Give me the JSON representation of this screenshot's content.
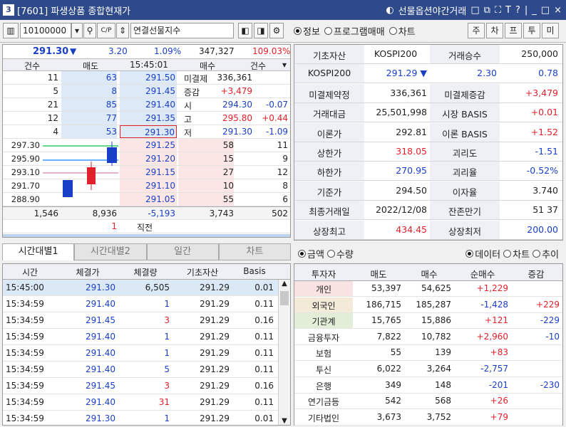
{
  "title": {
    "num": "3",
    "text": "[7601] 파생상품 종합현재가",
    "mode": "선물옵션야간거래",
    "icons": [
      "□",
      "⧉",
      "⛶",
      "T",
      "?",
      "|",
      "_",
      "□",
      "×"
    ]
  },
  "toolbar": {
    "code": "10100000",
    "name": "연결선물지수",
    "tabs_radio": [
      "정보",
      "프로그램매매",
      "차트"
    ],
    "buttons": [
      "주",
      "차",
      "프",
      "투",
      "미"
    ]
  },
  "quote": {
    "price": "291.30",
    "arrow": "▼",
    "change": "3.20",
    "rate": "1.09%",
    "volume": "347,327",
    "vol_rate": "109.03%"
  },
  "ob_header": [
    "건수",
    "매도",
    "15:45:01",
    "매수",
    "건수"
  ],
  "asks": [
    {
      "cnt": "11",
      "qty": "63",
      "price": "291.50"
    },
    {
      "cnt": "5",
      "qty": "8",
      "price": "291.45"
    },
    {
      "cnt": "21",
      "qty": "85",
      "price": "291.40"
    },
    {
      "cnt": "12",
      "qty": "77",
      "price": "291.35"
    },
    {
      "cnt": "4",
      "qty": "53",
      "price": "291.30"
    }
  ],
  "side_info": [
    {
      "label": "미결제",
      "value": "336,361",
      "chg": ""
    },
    {
      "label": "증감",
      "value": "+3,479",
      "chg": ""
    },
    {
      "label": "시",
      "value": "294.30",
      "chg": "-0.07"
    },
    {
      "label": "고",
      "value": "295.80",
      "chg": "+0.44"
    },
    {
      "label": "저",
      "value": "291.30",
      "chg": "-1.09"
    }
  ],
  "bids": [
    {
      "price": "291.25",
      "qty": "58",
      "cnt": "11"
    },
    {
      "price": "291.20",
      "qty": "15",
      "cnt": "9"
    },
    {
      "price": "291.15",
      "qty": "27",
      "cnt": "12"
    },
    {
      "price": "291.10",
      "qty": "10",
      "cnt": "8"
    },
    {
      "price": "291.05",
      "qty": "55",
      "cnt": "6"
    }
  ],
  "mini_chart_levels": [
    "297.30",
    "295.90",
    "293.10",
    "291.70",
    "288.90"
  ],
  "ob_total": {
    "ask_cnt": "1,546",
    "ask_qty": "8,936",
    "diff": "-5,193",
    "bid_qty": "3,743",
    "bid_cnt": "502"
  },
  "ob_last": {
    "value": "1",
    "label": "직전"
  },
  "tick_tabs": [
    "시간대별1",
    "시간대별2",
    "일간",
    "차트"
  ],
  "tick_header": [
    "시간",
    "체결가",
    "체결량",
    "기초자산",
    "Basis"
  ],
  "ticks": [
    {
      "time": "15:45:00",
      "price": "291.30",
      "qty": "6,505",
      "base": "291.29",
      "basis": "0.01",
      "qc": "k"
    },
    {
      "time": "15:34:59",
      "price": "291.40",
      "qty": "1",
      "base": "291.29",
      "basis": "0.11",
      "qc": "b"
    },
    {
      "time": "15:34:59",
      "price": "291.45",
      "qty": "3",
      "base": "291.29",
      "basis": "0.16",
      "qc": "r"
    },
    {
      "time": "15:34:59",
      "price": "291.40",
      "qty": "1",
      "base": "291.29",
      "basis": "0.11",
      "qc": "b"
    },
    {
      "time": "15:34:59",
      "price": "291.40",
      "qty": "1",
      "base": "291.29",
      "basis": "0.11",
      "qc": "b"
    },
    {
      "time": "15:34:59",
      "price": "291.40",
      "qty": "5",
      "base": "291.29",
      "basis": "0.11",
      "qc": "b"
    },
    {
      "time": "15:34:59",
      "price": "291.45",
      "qty": "3",
      "base": "291.29",
      "basis": "0.16",
      "qc": "r"
    },
    {
      "time": "15:34:59",
      "price": "291.40",
      "qty": "31",
      "base": "291.29",
      "basis": "0.11",
      "qc": "r"
    },
    {
      "time": "15:34:59",
      "price": "291.30",
      "qty": "1",
      "base": "291.29",
      "basis": "0.01",
      "qc": "b"
    }
  ],
  "info": [
    [
      {
        "t": "기초자산",
        "c": "l"
      },
      {
        "t": "KOSPI200",
        "c": "k"
      },
      {
        "t": "거래승수",
        "c": "l"
      },
      {
        "t": "250,000",
        "c": "k"
      }
    ],
    [
      {
        "t": "KOSPI200",
        "c": "l"
      },
      {
        "t": "291.29 ▼",
        "c": "b"
      },
      {
        "t": "2.30",
        "c": "b"
      },
      {
        "t": "0.78",
        "c": "b"
      }
    ],
    [
      {
        "t": "미결제약정",
        "c": "l"
      },
      {
        "t": "336,361",
        "c": "k"
      },
      {
        "t": "미결제증감",
        "c": "l"
      },
      {
        "t": "+3,479",
        "c": "r"
      }
    ],
    [
      {
        "t": "거래대금",
        "c": "l"
      },
      {
        "t": "25,501,998",
        "c": "k"
      },
      {
        "t": "시장 BASIS",
        "c": "l"
      },
      {
        "t": "+0.01",
        "c": "r"
      }
    ],
    [
      {
        "t": "이론가",
        "c": "l"
      },
      {
        "t": "292.81",
        "c": "k"
      },
      {
        "t": "이론 BASIS",
        "c": "l"
      },
      {
        "t": "+1.52",
        "c": "r"
      }
    ],
    [
      {
        "t": "상한가",
        "c": "l"
      },
      {
        "t": "318.05",
        "c": "r"
      },
      {
        "t": "괴리도",
        "c": "l"
      },
      {
        "t": "-1.51",
        "c": "b"
      }
    ],
    [
      {
        "t": "하한가",
        "c": "l"
      },
      {
        "t": "270.95",
        "c": "b"
      },
      {
        "t": "괴리율",
        "c": "l"
      },
      {
        "t": "-0.52%",
        "c": "b"
      }
    ],
    [
      {
        "t": "기준가",
        "c": "l"
      },
      {
        "t": "294.50",
        "c": "k"
      },
      {
        "t": "이자율",
        "c": "l"
      },
      {
        "t": "3.740",
        "c": "k"
      }
    ],
    [
      {
        "t": "최종거래일",
        "c": "l"
      },
      {
        "t": "2022/12/08",
        "c": "k"
      },
      {
        "t": "잔존만기",
        "c": "l"
      },
      {
        "t": "51    37",
        "c": "k"
      }
    ],
    [
      {
        "t": "상장최고",
        "c": "l"
      },
      {
        "t": "434.45",
        "c": "r"
      },
      {
        "t": "상장최저",
        "c": "l"
      },
      {
        "t": "200.00",
        "c": "b"
      }
    ]
  ],
  "inv_radio1": [
    "금액",
    "수량"
  ],
  "inv_radio2": [
    "데이터",
    "차트",
    "추이"
  ],
  "inv_header": [
    "투자자",
    "매도",
    "매수",
    "순매수",
    "증감"
  ],
  "investors": [
    {
      "name": "개인",
      "sell": "53,397",
      "buy": "54,625",
      "net": "+1,229",
      "chg": "",
      "nc": "r",
      "cc": "k",
      "bg": "#f8e2e2"
    },
    {
      "name": "외국인",
      "sell": "186,715",
      "buy": "185,287",
      "net": "-1,428",
      "chg": "+229",
      "nc": "b",
      "cc": "r",
      "bg": "#f3ead8"
    },
    {
      "name": "기관계",
      "sell": "15,765",
      "buy": "15,886",
      "net": "+121",
      "chg": "-229",
      "nc": "r",
      "cc": "b",
      "bg": "#e2eed8"
    },
    {
      "name": "금융투자",
      "sell": "7,822",
      "buy": "10,782",
      "net": "+2,960",
      "chg": "-10",
      "nc": "r",
      "cc": "b",
      "bg": "#fff"
    },
    {
      "name": "보험",
      "sell": "55",
      "buy": "139",
      "net": "+83",
      "chg": "",
      "nc": "r",
      "cc": "k",
      "bg": "#fff"
    },
    {
      "name": "투신",
      "sell": "6,022",
      "buy": "3,264",
      "net": "-2,757",
      "chg": "",
      "nc": "b",
      "cc": "k",
      "bg": "#fff"
    },
    {
      "name": "은행",
      "sell": "349",
      "buy": "148",
      "net": "-201",
      "chg": "-230",
      "nc": "b",
      "cc": "b",
      "bg": "#fff"
    },
    {
      "name": "연기금등",
      "sell": "542",
      "buy": "568",
      "net": "+26",
      "chg": "",
      "nc": "r",
      "cc": "k",
      "bg": "#fff"
    },
    {
      "name": "기타법인",
      "sell": "3,673",
      "buy": "3,752",
      "net": "+79",
      "chg": "",
      "nc": "r",
      "cc": "k",
      "bg": "#fff"
    }
  ],
  "colors": {
    "title_bg": "#2f4a8a",
    "ask_bg": "#dde9f7",
    "bid_bg": "#fbe6e6",
    "red": "#e0202a",
    "blue": "#1a3fc7"
  }
}
